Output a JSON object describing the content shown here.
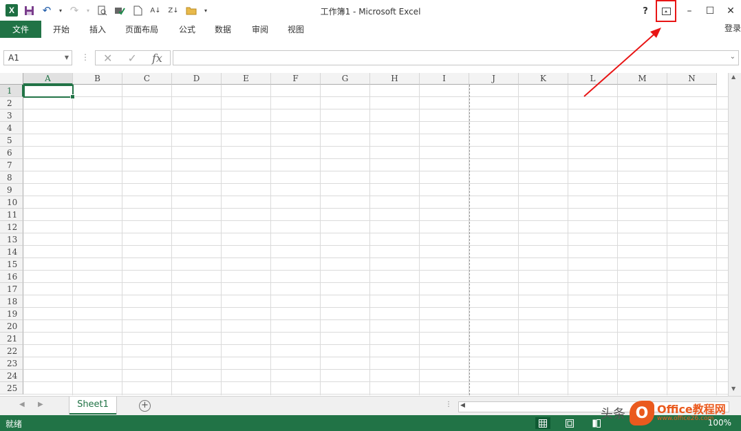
{
  "window": {
    "title": "工作簿1 - Microsoft Excel",
    "help_label": "?",
    "minimize_label": "–",
    "maximize_label": "☐",
    "close_label": "✕",
    "login_label": "登录"
  },
  "ribbon_tabs": {
    "file": "文件",
    "items": [
      "开始",
      "插入",
      "页面布局",
      "公式",
      "数据",
      "审阅",
      "视图"
    ]
  },
  "formula_bar": {
    "name_box": "A1",
    "fx_label": "fx",
    "content": ""
  },
  "grid": {
    "columns": [
      "A",
      "B",
      "C",
      "D",
      "E",
      "F",
      "G",
      "H",
      "I",
      "J",
      "K",
      "L",
      "M",
      "N"
    ],
    "rows": [
      "1",
      "2",
      "3",
      "4",
      "5",
      "6",
      "7",
      "8",
      "9",
      "10",
      "11",
      "12",
      "13",
      "14",
      "15",
      "16",
      "17",
      "18",
      "19",
      "20",
      "21",
      "22",
      "23",
      "24",
      "25"
    ],
    "active_cell": "A1"
  },
  "sheet_bar": {
    "sheet_tab": "Sheet1",
    "add_label": "+"
  },
  "status_bar": {
    "ready": "就绪",
    "zoom": "100%"
  },
  "watermark": {
    "prefix": "头条",
    "logo": "O",
    "brand": "Office教程网",
    "url": "www.office26.com"
  },
  "colors": {
    "accent": "#217346",
    "annotation": "#e81414"
  }
}
